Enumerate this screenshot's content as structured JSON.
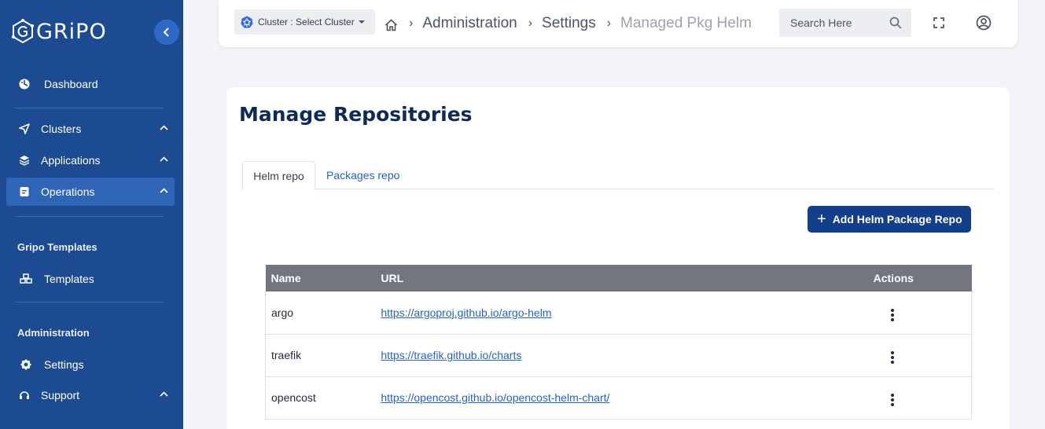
{
  "app": {
    "brand": "GRiPO"
  },
  "sidebar": {
    "items": [
      {
        "label": "Dashboard"
      },
      {
        "label": "Clusters"
      },
      {
        "label": "Applications"
      },
      {
        "label": "Operations"
      }
    ],
    "sections": [
      {
        "title": "Gripo Templates",
        "items": [
          {
            "label": "Templates"
          }
        ]
      },
      {
        "title": "Administration",
        "items": [
          {
            "label": "Settings"
          },
          {
            "label": "Support"
          }
        ]
      }
    ]
  },
  "header": {
    "cluster_select": "Cluster : Select Cluster",
    "breadcrumbs": [
      "Administration",
      "Settings",
      "Managed Pkg Helm"
    ],
    "search_placeholder": "Search Here"
  },
  "main": {
    "title": "Manage Repositories",
    "tabs": [
      {
        "label": "Helm repo"
      },
      {
        "label": "Packages repo"
      }
    ],
    "add_button": "Add Helm Package Repo",
    "table": {
      "columns": [
        "Name",
        "URL",
        "Actions"
      ],
      "rows": [
        {
          "name": "argo",
          "url": "https://argoproj.github.io/argo-helm"
        },
        {
          "name": "traefik",
          "url": "https://traefik.github.io/charts"
        },
        {
          "name": "opencost",
          "url": "https://opencost.github.io/opencost-helm-chart/"
        }
      ]
    }
  },
  "colors": {
    "sidebar_bg": "#1d4b91",
    "active_item": "#2f65b7",
    "primary_button": "#123e8c",
    "link": "#2563c9",
    "table_header": "#72777f"
  }
}
